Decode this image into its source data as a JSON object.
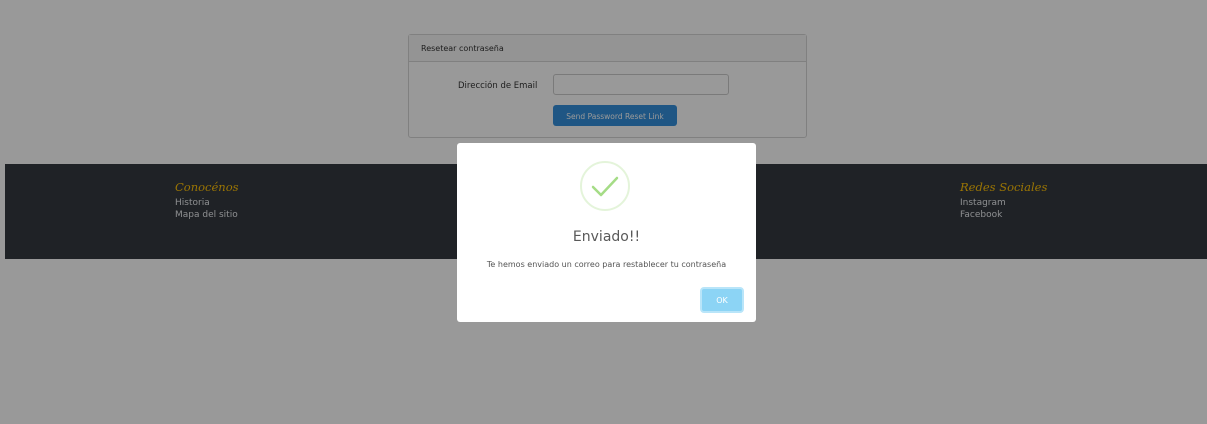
{
  "reset_form": {
    "header": "Resetear contraseña",
    "email_label": "Dirección de Email",
    "email_value": "",
    "submit_label": "Send Password Reset Link"
  },
  "footer": {
    "left": {
      "title": "Conocénos",
      "links": [
        "Historia",
        "Mapa del sitio"
      ]
    },
    "right": {
      "title": "Redes Sociales",
      "links": [
        "Instagram",
        "Facebook"
      ]
    }
  },
  "modal": {
    "icon": "success-check-icon",
    "title": "Enviado!!",
    "text": "Te hemos enviado un correo para restablecer tu contraseña",
    "ok_label": "OK"
  },
  "colors": {
    "overlay": "#959595",
    "footer_bg": "#343a40",
    "footer_title": "#ffc107",
    "primary_button": "#3490dc",
    "ok_button": "#8cd4f5",
    "success": "#a5dc86"
  }
}
